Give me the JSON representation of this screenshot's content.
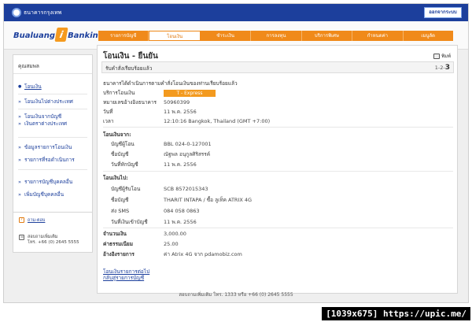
{
  "topbar": {
    "bank_name": "ธนาคารกรุงเทพ",
    "logout_label": "ออกจากระบบ"
  },
  "brand": {
    "left": "Bualuang",
    "i": "i",
    "right": "Banking"
  },
  "menu": [
    "รายการบัญชี",
    "โอนเงิน",
    "ชำระเงิน",
    "การลงทุน",
    "บริการพิเศษ",
    "กำหนดค่า",
    "เมนูลัด"
  ],
  "sidebar": {
    "title": "คุณสมพล",
    "items": [
      "โอนเงิน",
      "โอนเงินไปต่างประเทศ",
      "โอนเงินจากบัญชี",
      "เงินตราต่างประเทศ",
      "ข้อมูลรายการโอนเงิน",
      "รายการที่รอดำเนินการ",
      "รายการบัญชีบุคคลอื่น",
      "เพิ่มบัญชีบุคคลอื่น"
    ],
    "help_link": "ถาม-ตอบ",
    "contact_label": "สอบถามเพิ่มเติม",
    "contact_phone": "โทร. +66 (0) 2645 5555"
  },
  "main": {
    "title": "โอนเงิน - ยืนยัน",
    "print_label": "พิมพ์",
    "status": "รับคำสั่งเรียบร้อยแล้ว",
    "steps_prefix": "1-2-",
    "steps_current": "3",
    "note": "ธนาคารได้ดำเนินการตามคำสั่งโอนเงินของท่านเรียบร้อยแล้ว",
    "service_label": "บริการโอนเงิน",
    "service_value": "T - Express",
    "ref_label": "หมายเลขอ้างอิงธนาคาร",
    "ref_value": "50960399",
    "date_label": "วันที่",
    "date_value": "11 พ.ค. 2556",
    "time_label": "เวลา",
    "time_value": "12:10:16 Bangkok, Thailand (GMT +7:00)",
    "from_header": "โอนเงินจาก:",
    "from_acc_label": "บัญชีผู้โอน",
    "from_acc_value": "BBL 024-0-127001",
    "from_name_label": "ชื่อบัญชี",
    "from_name_value": "ณัฐพล อนุกูลศิริสรรค์",
    "from_debit_label": "วันที่หักบัญชี",
    "from_debit_value": "11 พ.ค. 2556",
    "to_header": "โอนเงินไป:",
    "to_acc_label": "บัญชีผู้รับโอน",
    "to_acc_value": "SCB 8572015343",
    "to_name_label": "ชื่อบัญชี",
    "to_name_value": "THARIT INTAPA / ซื้อ ลูเท็ค ATRIX 4G",
    "sms_label": "ส่ง SMS",
    "sms_value": "084 058 0863",
    "credit_label": "วันที่เงินเข้าบัญชี",
    "credit_value": "11 พ.ค. 2556",
    "amount_label": "จำนวนเงิน",
    "amount_value": "3,000.00",
    "fee_label": "ค่าธรรมเนียม",
    "fee_value": "25.00",
    "memo_label": "อ้างอิงรายการ",
    "memo_value": "ค่า Atrix 4G จาก pdamobiz.com",
    "link1": "โอนเงินรายการต่อไป",
    "link2": "กลับสู่รายการบัญชี"
  },
  "footer": "สอบถามเพิ่มเติม โทร. 1333 หรือ +66 (0) 2645 5555",
  "watermark": "[1039x675] https://upic.me/"
}
